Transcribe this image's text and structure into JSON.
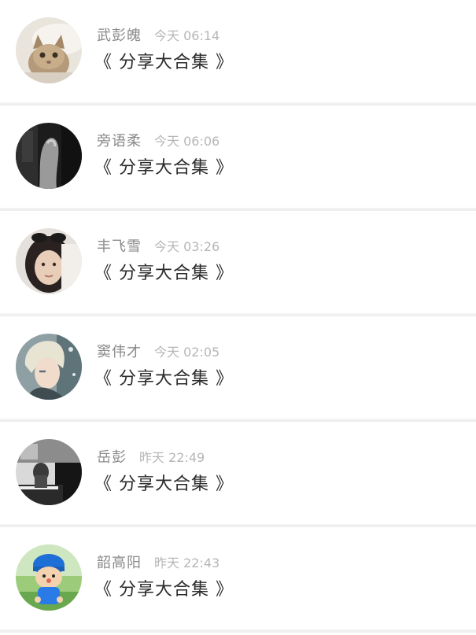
{
  "posts": [
    {
      "name": "武彭魄",
      "time": "今天 06:14",
      "title": "《 分享大合集 》",
      "avatar": "kitten-avatar"
    },
    {
      "name": "旁语柔",
      "time": "今天 06:06",
      "title": "《 分享大合集 》",
      "avatar": "hand-bw-avatar"
    },
    {
      "name": "丰飞雪",
      "time": "今天 03:26",
      "title": "《 分享大合集 》",
      "avatar": "girl-portrait-avatar"
    },
    {
      "name": "窦伟才",
      "time": "今天 02:05",
      "title": "《 分享大合集 》",
      "avatar": "anime-boy-avatar"
    },
    {
      "name": "岳彭",
      "time": "昨天 22:49",
      "title": "《 分享大合集 》",
      "avatar": "piano-bw-avatar"
    },
    {
      "name": "韶高阳",
      "time": "昨天 22:43",
      "title": "《 分享大合集 》",
      "avatar": "blue-cartoon-avatar"
    }
  ]
}
